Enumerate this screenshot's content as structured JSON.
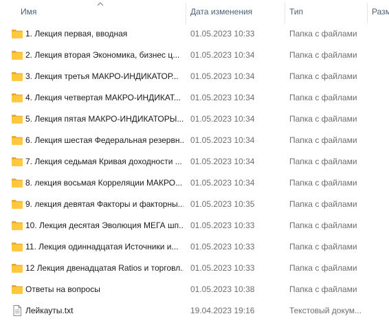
{
  "columns": {
    "name": "Имя",
    "date": "Дата изменения",
    "type": "Тип",
    "size": "Разм"
  },
  "sort": {
    "column": "name",
    "icon": "sort-up-icon"
  },
  "colors": {
    "folder": "#ffc83d",
    "folder_dark": "#e8a928",
    "header_text": "#4c607a",
    "secondary_text": "#6d6d6d"
  },
  "files": [
    {
      "name": "1. Лекция первая, вводная",
      "date": "01.05.2023 10:33",
      "type": "Папка с файлами",
      "icon": "folder-icon"
    },
    {
      "name": "2. Лекция вторая Экономика, бизнес ц...",
      "date": "01.05.2023 10:34",
      "type": "Папка с файлами",
      "icon": "folder-icon"
    },
    {
      "name": "3. Лекция третья МАКРО-ИНДИКАТОР...",
      "date": "01.05.2023 10:34",
      "type": "Папка с файлами",
      "icon": "folder-icon"
    },
    {
      "name": "4. Лекция четвертая МАКРО-ИНДИКАТ...",
      "date": "01.05.2023 10:34",
      "type": "Папка с файлами",
      "icon": "folder-icon"
    },
    {
      "name": "5. Лекция пятая МАКРО-ИНДИКАТОРЫ...",
      "date": "01.05.2023 10:34",
      "type": "Папка с файлами",
      "icon": "folder-icon"
    },
    {
      "name": "6. Лекция шестая Федеральная резервн...",
      "date": "01.05.2023 10:34",
      "type": "Папка с файлами",
      "icon": "folder-icon"
    },
    {
      "name": "7. Лекция седьмая Кривая доходности ...",
      "date": "01.05.2023 10:34",
      "type": "Папка с файлами",
      "icon": "folder-icon"
    },
    {
      "name": "8. лекция восьмая Корреляции МАКРО...",
      "date": "01.05.2023 10:34",
      "type": "Папка с файлами",
      "icon": "folder-icon"
    },
    {
      "name": "9. лекция девятая Факторы и факторны...",
      "date": "01.05.2023 10:35",
      "type": "Папка с файлами",
      "icon": "folder-icon"
    },
    {
      "name": "10. Лекция десятая Эволюция МЕГА шп...",
      "date": "01.05.2023 10:33",
      "type": "Папка с файлами",
      "icon": "folder-icon"
    },
    {
      "name": "11. Лекция одиннадцатая Источники и...",
      "date": "01.05.2023 10:33",
      "type": "Папка с файлами",
      "icon": "folder-icon"
    },
    {
      "name": "12 Лекция двенадцатая Ratios и торговл...",
      "date": "01.05.2023 10:33",
      "type": "Папка с файлами",
      "icon": "folder-icon"
    },
    {
      "name": "Ответы на вопросы",
      "date": "01.05.2023 10:38",
      "type": "Папка с файлами",
      "icon": "folder-icon"
    },
    {
      "name": "Лейкауты.txt",
      "date": "19.04.2023 19:16",
      "type": "Текстовый докум...",
      "icon": "text-file-icon"
    }
  ]
}
